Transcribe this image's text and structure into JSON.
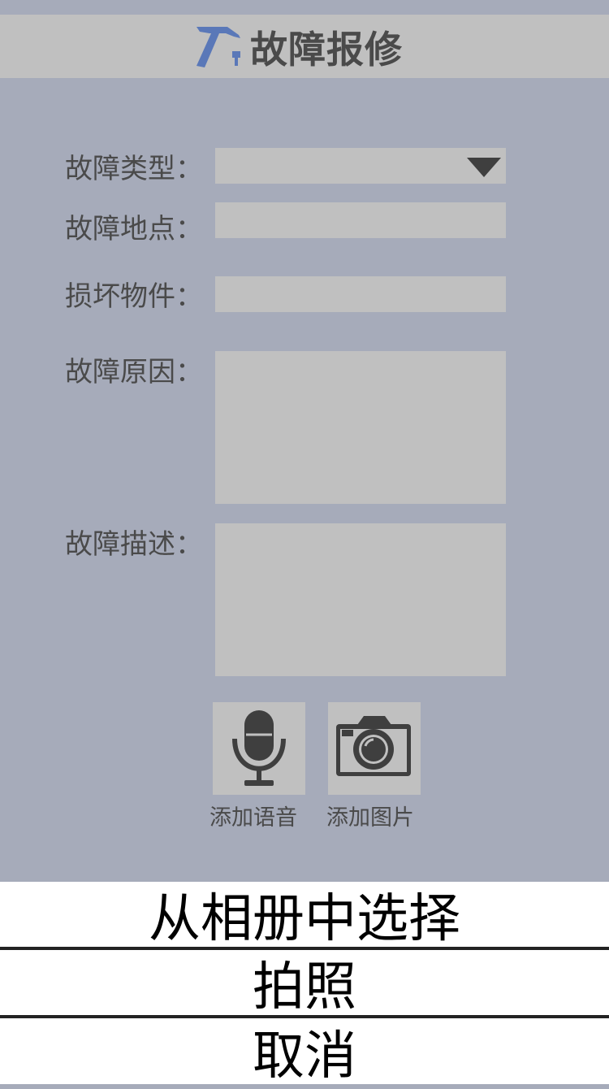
{
  "header": {
    "title": "故障报修",
    "icon": "hammer-icon"
  },
  "form": {
    "fault_type": {
      "label": "故障类型：",
      "value": ""
    },
    "fault_location": {
      "label": "故障地点：",
      "value": ""
    },
    "damaged_item": {
      "label": "损坏物件：",
      "value": ""
    },
    "fault_cause": {
      "label": "故障原因：",
      "value": ""
    },
    "fault_description": {
      "label": "故障描述：",
      "value": ""
    }
  },
  "media": {
    "voice": {
      "label": "添加语音",
      "icon": "microphone-icon"
    },
    "photo": {
      "label": "添加图片",
      "icon": "camera-icon"
    }
  },
  "action_sheet": {
    "album": "从相册中选择",
    "camera": "拍照",
    "cancel": "取消"
  },
  "colors": {
    "background": "#a6abba",
    "field": "#c0c0c0",
    "icon_accent": "#5a78b8",
    "text": "#4a4a4a"
  }
}
